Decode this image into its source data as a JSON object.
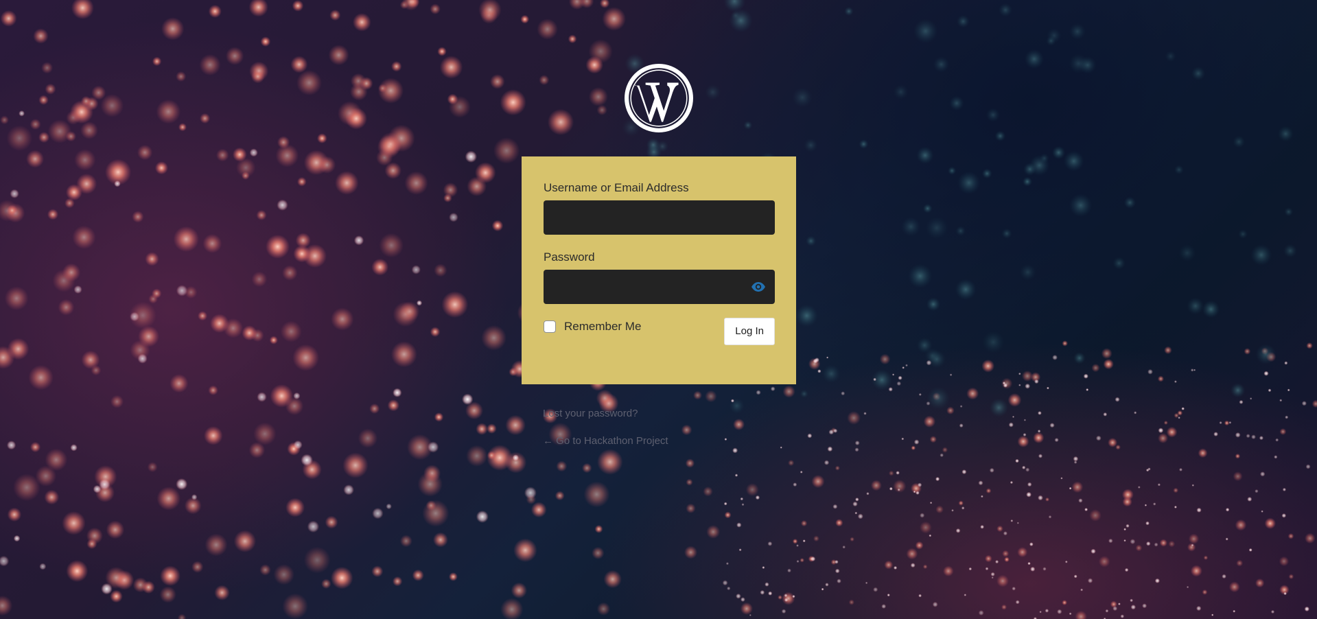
{
  "logo": {
    "icon": "wordpress-logo-icon"
  },
  "form": {
    "username_label": "Username or Email Address",
    "username_value": "",
    "password_label": "Password",
    "password_value": "",
    "remember_label": "Remember Me",
    "remember_checked": false,
    "submit_label": "Log In",
    "show_password_icon": "eye-icon"
  },
  "links": {
    "lost_password": "Lost your password?",
    "back_to_site": "← Go to Hackathon Project"
  },
  "colors": {
    "login_box_bg": "#d7c36c",
    "input_bg": "#232323",
    "eye_icon": "#2271b1",
    "link_text": "#5e6070"
  }
}
